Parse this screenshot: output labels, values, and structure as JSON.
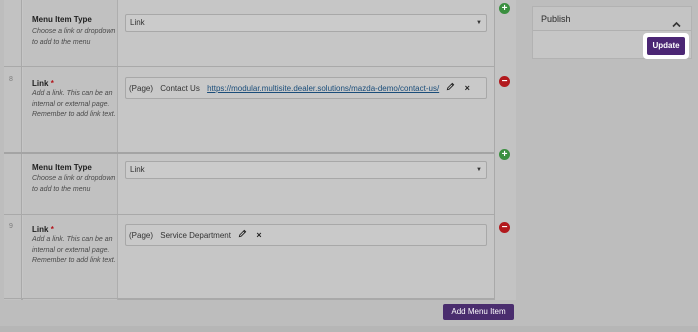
{
  "menu_items": [
    {
      "type_field": {
        "label": "Menu Item Type",
        "description": "Choose a link or dropdown to add to the menu",
        "selected": "Link"
      },
      "link_field": {
        "row_number": "8",
        "label": "Link",
        "required_mark": "*",
        "description": "Add a link. This can be an internal or external page. Remember to add link text.",
        "page_tag": "(Page)",
        "page_name": "Contact Us",
        "url": "https://modular.multisite.dealer.solutions/mazda-demo/contact-us/",
        "remove_glyph": "×"
      }
    },
    {
      "type_field": {
        "label": "Menu Item Type",
        "description": "Choose a link or dropdown to add to the menu",
        "selected": "Link"
      },
      "link_field": {
        "row_number": "9",
        "label": "Link",
        "required_mark": "*",
        "description": "Add a link. This can be an internal or external page. Remember to add link text.",
        "page_tag": "(Page)",
        "page_name": "Service Department",
        "url": "",
        "remove_glyph": "×"
      }
    }
  ],
  "row_controls": {
    "add_glyph": "+",
    "remove_glyph": "−"
  },
  "select_arrow": "▼",
  "add_menu_item_label": "Add Menu Item",
  "publish": {
    "title": "Publish",
    "update_label": "Update"
  },
  "icons": [
    "pencil-icon",
    "chevron-up-icon",
    "add-row-icon",
    "remove-row-icon",
    "dropdown-arrow-icon"
  ],
  "colors": {
    "accent": "#4b2674",
    "add": "#3a8f3f",
    "remove": "#b2191d",
    "link": "#1a4d7a"
  }
}
